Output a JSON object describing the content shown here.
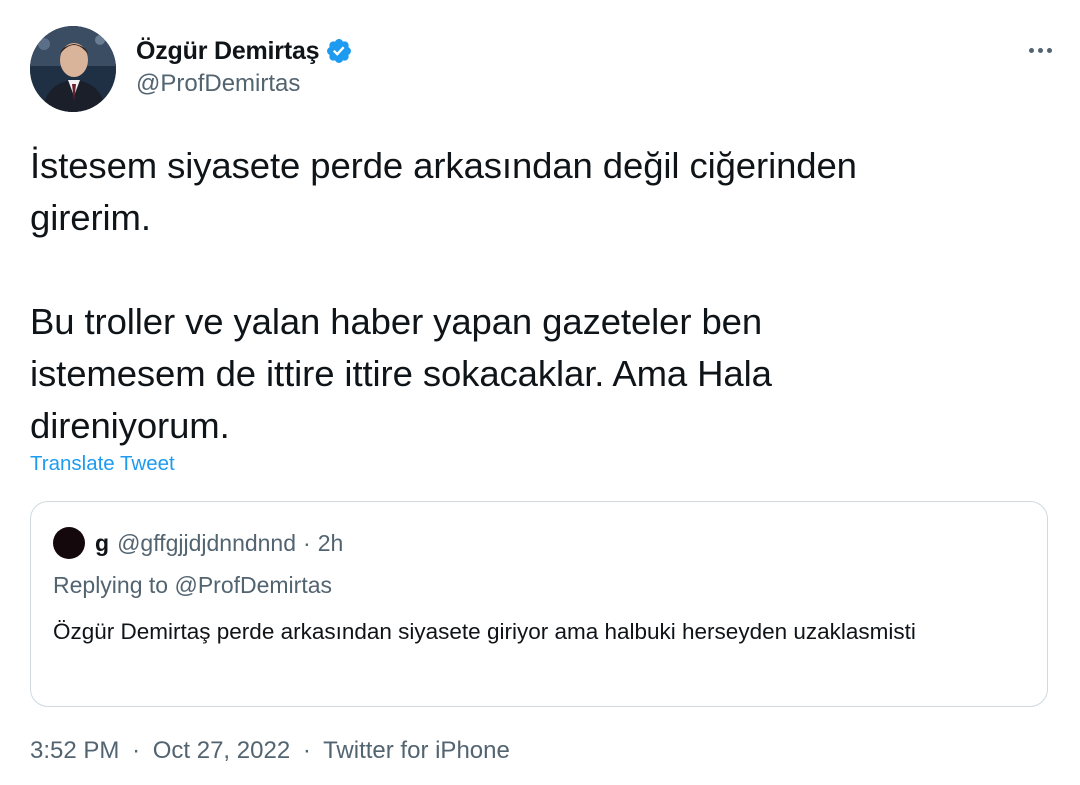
{
  "author": {
    "display_name": "Özgür Demirtaş",
    "handle": "@ProfDemirtas",
    "verified_icon": "verified-badge-icon",
    "accent": "#1d9bf0"
  },
  "tweet": {
    "text": "İstesem siyasete perde arkasından değil ciğerinden\ngirerim.\n\nBu troller ve yalan haber yapan gazeteler ben\nistemesem de ittire ittire sokacaklar. Ama Hala\ndireniyorum.",
    "translate_label": "Translate Tweet"
  },
  "quote": {
    "name": "g",
    "handle": "@gffgjjdjdnndnnd",
    "separator": "·",
    "time": "2h",
    "replying_prefix": "Replying to",
    "replying_to": "@ProfDemirtas",
    "text": "Özgür Demirtaş perde arkasından siyasete giriyor ama halbuki herseyden uzaklasmisti"
  },
  "footer": {
    "time": "3:52 PM",
    "separator": "·",
    "date": "Oct 27, 2022",
    "source": "Twitter for iPhone"
  }
}
